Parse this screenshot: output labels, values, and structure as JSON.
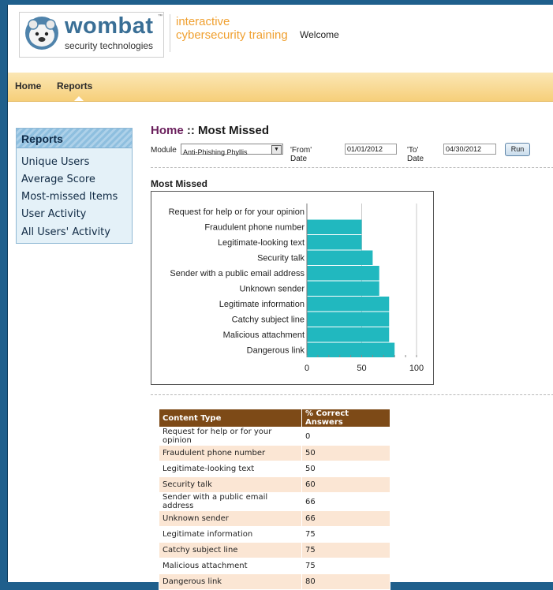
{
  "brand": {
    "logo_word": "wombat",
    "logo_sub": "security technologies",
    "tm": "™",
    "tagline_line1": "interactive",
    "tagline_line2": "cybersecurity training",
    "welcome": "Welcome"
  },
  "nav": {
    "home": "Home",
    "reports": "Reports"
  },
  "sidebar": {
    "title": "Reports",
    "items": [
      "Unique Users",
      "Average Score",
      "Most-missed Items",
      "User Activity",
      "All Users' Activity"
    ]
  },
  "page": {
    "crumb_home": "Home",
    "crumb_sep": " :: ",
    "crumb_title": "Most Missed"
  },
  "filters": {
    "module_label": "Module",
    "module_value": "Anti-Phishing Phyllis",
    "from_label": "'From' Date",
    "from_value": "01/01/2012",
    "to_label": "'To' Date",
    "to_value": "04/30/2012",
    "run_label": "Run"
  },
  "section_title": "Most Missed",
  "chart_data": {
    "type": "bar",
    "orientation": "horizontal",
    "categories": [
      "Request for help or for your opinion",
      "Fraudulent phone number",
      "Legitimate-looking text",
      "Security talk",
      "Sender with a public email address",
      "Unknown sender",
      "Legitimate information",
      "Catchy subject line",
      "Malicious attachment",
      "Dangerous link"
    ],
    "values": [
      0,
      50,
      50,
      60,
      66,
      66,
      75,
      75,
      75,
      80
    ],
    "xlim": [
      0,
      100
    ],
    "xticks": [
      "0",
      "50",
      "100"
    ],
    "bar_color": "#21b8bf",
    "grid": true
  },
  "table": {
    "headers": [
      "Content Type",
      "% Correct Answers"
    ],
    "rows": [
      [
        "Request for help or for your opinion",
        "0"
      ],
      [
        "Fraudulent phone number",
        "50"
      ],
      [
        "Legitimate-looking text",
        "50"
      ],
      [
        "Security talk",
        "60"
      ],
      [
        "Sender with a public email address",
        "66"
      ],
      [
        "Unknown sender",
        "66"
      ],
      [
        "Legitimate information",
        "75"
      ],
      [
        "Catchy subject line",
        "75"
      ],
      [
        "Malicious attachment",
        "75"
      ],
      [
        "Dangerous link",
        "80"
      ]
    ]
  },
  "colors": {
    "frame_bg": "#1f5f8c",
    "nav_bg": "#f6cf7a",
    "table_header": "#7d4a17",
    "row_alt": "#fbe6d4",
    "tagline": "#f0a030",
    "crumb_home": "#6a1f5c"
  }
}
